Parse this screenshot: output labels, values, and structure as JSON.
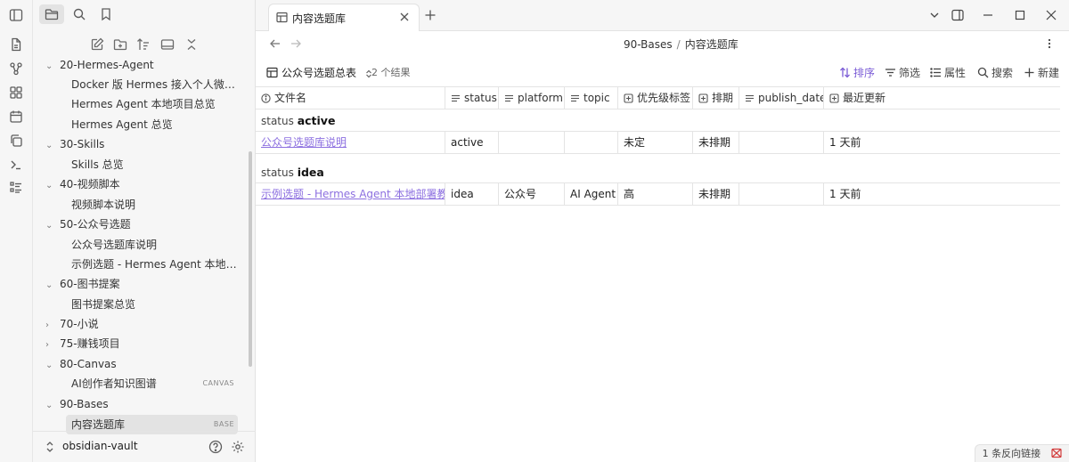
{
  "ribbon": {
    "icons": [
      "sidebar-toggle-icon",
      "file-icon",
      "graph-icon",
      "blocks-icon",
      "calendar-icon",
      "copy-icon",
      "terminal-icon",
      "list-icon"
    ]
  },
  "sidebar": {
    "top_icons": [
      "folder-icon",
      "search-icon",
      "bookmark-icon"
    ],
    "actions": [
      "new-note-icon",
      "new-folder-icon",
      "sort-icon",
      "collapse-all-icon",
      "chevrons-icon"
    ],
    "tree": [
      {
        "type": "folder",
        "label": "20-Hermes-Agent",
        "expanded": true
      },
      {
        "type": "file",
        "label": "Docker 版 Hermes 接入个人微信..."
      },
      {
        "type": "file",
        "label": "Hermes Agent 本地项目总览"
      },
      {
        "type": "file",
        "label": "Hermes Agent 总览"
      },
      {
        "type": "folder",
        "label": "30-Skills",
        "expanded": true
      },
      {
        "type": "file",
        "label": "Skills 总览"
      },
      {
        "type": "folder",
        "label": "40-视频脚本",
        "expanded": true
      },
      {
        "type": "file",
        "label": "视频脚本说明"
      },
      {
        "type": "folder",
        "label": "50-公众号选题",
        "expanded": true
      },
      {
        "type": "file",
        "label": "公众号选题库说明"
      },
      {
        "type": "file",
        "label": "示例选题 - Hermes Agent 本地部..."
      },
      {
        "type": "folder",
        "label": "60-图书提案",
        "expanded": true
      },
      {
        "type": "file",
        "label": "图书提案总览"
      },
      {
        "type": "folder",
        "label": "70-小说",
        "expanded": false
      },
      {
        "type": "folder",
        "label": "75-赚钱项目",
        "expanded": false
      },
      {
        "type": "folder",
        "label": "80-Canvas",
        "expanded": true
      },
      {
        "type": "file",
        "label": "AI创作者知识图谱",
        "tag": "CANVAS"
      },
      {
        "type": "folder",
        "label": "90-Bases",
        "expanded": true
      },
      {
        "type": "file",
        "label": "内容选题库",
        "tag": "BASE",
        "selected": true
      }
    ],
    "vault_name": "obsidian-vault"
  },
  "tab": {
    "title": "内容选题库"
  },
  "breadcrumb": {
    "folder": "90-Bases",
    "separator": "/",
    "file": "内容选题库"
  },
  "toolbar": {
    "view_name": "公众号选题总表",
    "result_count": "2 个结果",
    "sort_label": "排序",
    "filter_label": "筛选",
    "properties_label": "属性",
    "search_label": "搜索",
    "new_label": "新建"
  },
  "table": {
    "columns": [
      "文件名",
      "status",
      "platform",
      "topic",
      "优先级标签",
      "排期",
      "publish_date",
      "最近更新"
    ],
    "column_icons": [
      "info-icon",
      "text-icon",
      "text-icon",
      "text-icon",
      "checkbox-icon",
      "checkbox-icon",
      "text-icon",
      "checkbox-icon"
    ],
    "groups": [
      {
        "prefix": "status",
        "value": "active",
        "rows": [
          [
            "公众号选题库说明",
            "active",
            "",
            "",
            "未定",
            "未排期",
            "",
            "1 天前"
          ]
        ]
      },
      {
        "prefix": "status",
        "value": "idea",
        "rows": [
          [
            "示例选题 - Hermes Agent 本地部署教程",
            "idea",
            "公众号",
            "AI Agent",
            "高",
            "未排期",
            "",
            "1 天前"
          ]
        ]
      }
    ]
  },
  "status_bar": {
    "backlinks": "1 条反向链接"
  },
  "colors": {
    "accent": "#7b5cd6",
    "link": "#8c6fe0",
    "sidebar_bg": "#f6f6f6",
    "error": "#d23c3c"
  }
}
